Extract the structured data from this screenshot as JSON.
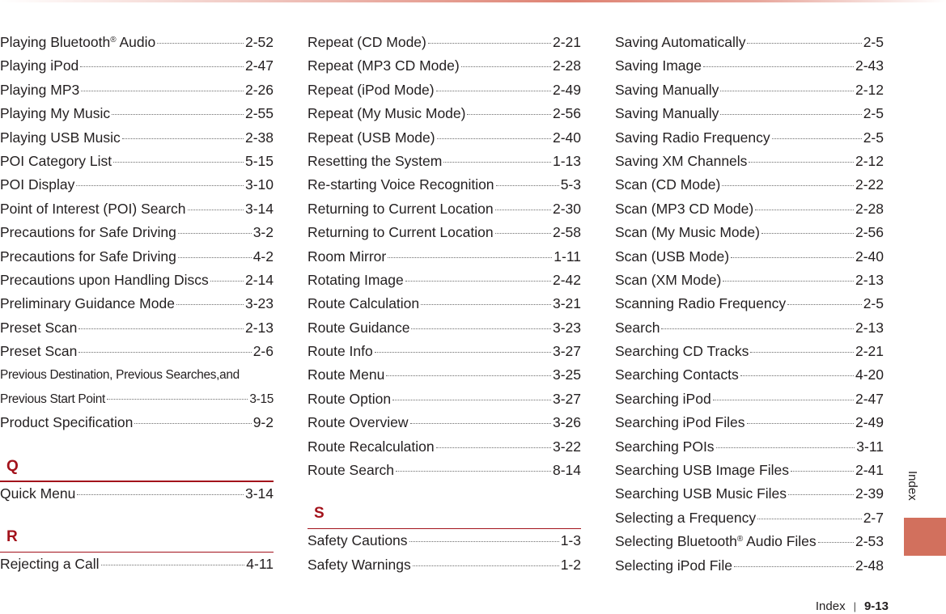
{
  "page": {
    "side_tab_label": "Index",
    "accent_color": "#a3121b",
    "tab_color": "#d2705d",
    "footer": {
      "section": "Index",
      "separator": "|",
      "page_number": "9-13"
    }
  },
  "columns": [
    {
      "blocks": [
        {
          "type": "entries",
          "items": [
            {
              "term": "Playing Bluetooth",
              "sup": "®",
              "term_after": " Audio",
              "page": "2-52"
            },
            {
              "term": "Playing iPod",
              "page": "2-47"
            },
            {
              "term": "Playing MP3",
              "page": "2-26"
            },
            {
              "term": "Playing My Music",
              "page": "2-55"
            },
            {
              "term": "Playing USB Music",
              "page": "2-38"
            },
            {
              "term": "POI Category List",
              "page": "5-15"
            },
            {
              "term": "POI Display",
              "page": "3-10"
            },
            {
              "term": "Point of Interest (POI) Search",
              "page": "3-14"
            },
            {
              "term": "Precautions for Safe Driving",
              "page": "3-2"
            },
            {
              "term": "Precautions for Safe Driving",
              "page": "4-2"
            },
            {
              "term": "Precautions upon Handling Discs",
              "page": "2-14"
            },
            {
              "term": "Preliminary Guidance Mode",
              "page": "3-23"
            },
            {
              "term": "Preset Scan",
              "page": "2-13"
            },
            {
              "term": "Preset Scan",
              "page": "2-6"
            },
            {
              "term": "Previous Destination, Previous Searches,and",
              "page": "",
              "small": true,
              "plain": true
            },
            {
              "term": "Previous Start Point",
              "page": "3-15",
              "small": true
            },
            {
              "term": "Product Specification",
              "page": "9-2"
            }
          ]
        },
        {
          "type": "section",
          "letter": "Q"
        },
        {
          "type": "entries",
          "items": [
            {
              "term": "Quick Menu",
              "page": "3-14"
            }
          ]
        },
        {
          "type": "section",
          "letter": "R"
        },
        {
          "type": "entries",
          "items": [
            {
              "term": "Rejecting a Call",
              "page": "4-11"
            }
          ]
        }
      ]
    },
    {
      "blocks": [
        {
          "type": "entries",
          "items": [
            {
              "term": "Repeat (CD Mode)",
              "page": "2-21"
            },
            {
              "term": "Repeat (MP3 CD Mode)",
              "page": "2-28"
            },
            {
              "term": "Repeat (iPod Mode)",
              "page": "2-49"
            },
            {
              "term": "Repeat (My Music Mode)",
              "page": "2-56"
            },
            {
              "term": "Repeat (USB Mode)",
              "page": "2-40"
            },
            {
              "term": "Resetting the System",
              "page": "1-13"
            },
            {
              "term": "Re-starting Voice Recognition",
              "page": "5-3"
            },
            {
              "term": "Returning to Current Location",
              "page": "2-30"
            },
            {
              "term": "Returning to Current Location",
              "page": "2-58"
            },
            {
              "term": "Room Mirror",
              "page": "1-11"
            },
            {
              "term": "Rotating Image",
              "page": "2-42"
            },
            {
              "term": "Route Calculation",
              "page": "3-21"
            },
            {
              "term": "Route Guidance",
              "page": "3-23"
            },
            {
              "term": "Route Info",
              "page": "3-27"
            },
            {
              "term": "Route Menu",
              "page": "3-25"
            },
            {
              "term": "Route Option",
              "page": "3-27"
            },
            {
              "term": "Route Overview",
              "page": "3-26"
            },
            {
              "term": "Route Recalculation",
              "page": "3-22"
            },
            {
              "term": "Route Search",
              "page": "8-14"
            }
          ]
        },
        {
          "type": "section",
          "letter": "S"
        },
        {
          "type": "entries",
          "items": [
            {
              "term": "Safety Cautions",
              "page": "1-3"
            },
            {
              "term": "Safety Warnings",
              "page": "1-2"
            }
          ]
        }
      ]
    },
    {
      "blocks": [
        {
          "type": "entries",
          "items": [
            {
              "term": "Saving Automatically",
              "page": "2-5"
            },
            {
              "term": "Saving Image",
              "page": "2-43"
            },
            {
              "term": "Saving Manually",
              "page": "2-12"
            },
            {
              "term": "Saving Manually",
              "page": "2-5"
            },
            {
              "term": "Saving Radio Frequency",
              "page": "2-5"
            },
            {
              "term": "Saving XM Channels",
              "page": "2-12"
            },
            {
              "term": "Scan (CD Mode)",
              "page": "2-22"
            },
            {
              "term": "Scan (MP3 CD Mode)",
              "page": "2-28"
            },
            {
              "term": "Scan (My Music Mode)",
              "page": "2-56"
            },
            {
              "term": "Scan (USB Mode)",
              "page": "2-40"
            },
            {
              "term": "Scan (XM Mode)",
              "page": "2-13"
            },
            {
              "term": "Scanning Radio Frequency",
              "page": "2-5"
            },
            {
              "term": "Search",
              "page": "2-13"
            },
            {
              "term": "Searching CD Tracks",
              "page": "2-21"
            },
            {
              "term": "Searching Contacts",
              "page": "4-20"
            },
            {
              "term": "Searching iPod",
              "page": "2-47"
            },
            {
              "term": "Searching iPod Files",
              "page": "2-49"
            },
            {
              "term": "Searching POIs",
              "page": "3-11"
            },
            {
              "term": "Searching USB Image Files",
              "page": "2-41"
            },
            {
              "term": "Searching USB Music Files",
              "page": "2-39"
            },
            {
              "term": "Selecting a Frequency",
              "page": "2-7"
            },
            {
              "term": "Selecting Bluetooth",
              "sup": "®",
              "term_after": " Audio Files",
              "page": "2-53"
            },
            {
              "term": "Selecting iPod File",
              "page": "2-48"
            }
          ]
        }
      ]
    }
  ]
}
